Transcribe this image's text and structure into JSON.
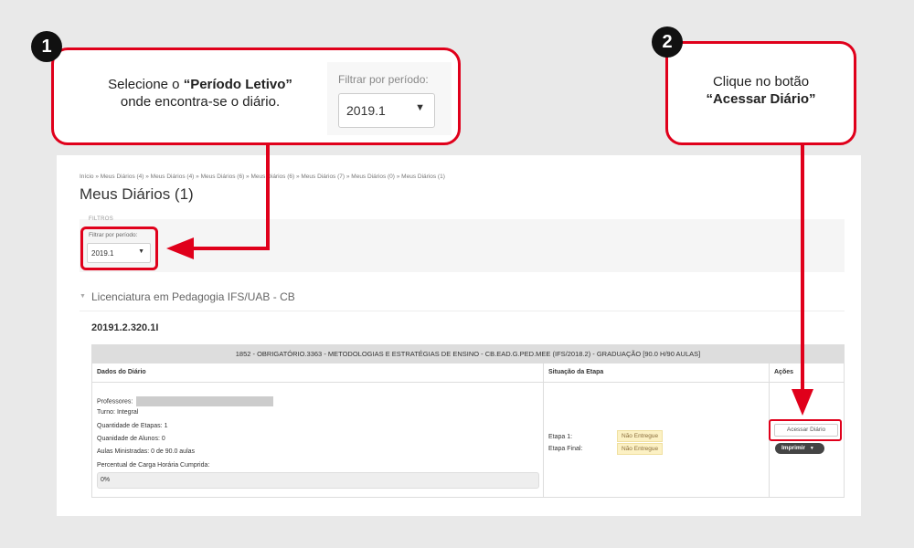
{
  "step1": {
    "number": "1",
    "text_prefix": "Selecione o ",
    "text_bold": "“Período Letivo”",
    "text_suffix": "onde encontra-se o diário.",
    "zoom_label": "Filtrar por período:",
    "zoom_value": "2019.1",
    "caret": "▼"
  },
  "step2": {
    "number": "2",
    "text_line1": "Clique no botão",
    "text_bold": "“Acessar Diário”"
  },
  "page": {
    "breadcrumb": "Início » Meus Diários (4) » Meus Diários (4) » Meus Diários (6) » Meus Diários (6) » Meus Diários (7) » Meus Diários (0) » Meus Diários (1)",
    "title": "Meus Diários (1)",
    "filters_label": "FILTROS",
    "filter_label": "Filtrar por período:",
    "filter_value": "2019.1",
    "caret": "▼",
    "course_toggle": "▼",
    "course_title": "Licenciatura em Pedagogia IFS/UAB - CB",
    "class_code": "20191.2.320.1I"
  },
  "table": {
    "caption": "1852 - OBRIGATÓRIO.3363 - METODOLOGIAS E ESTRATÉGIAS DE ENSINO - CB.EAD.G.PED.MEE (IFS/2018.2) - GRADUAÇÃO [90.0 H/90 AULAS]",
    "headers": [
      "Dados do Diário",
      "Situação da Etapa",
      "Ações"
    ],
    "details": {
      "professores_label": "Professores:",
      "turno_label": "Turno:",
      "turno_value": "Integral",
      "etapas_label": "Quantidade de Etapas:",
      "etapas_value": "1",
      "alunos_label": "Quanidade de Alunos:",
      "alunos_value": "0",
      "aulas_label": "Aulas Ministradas:",
      "aulas_value": "0 de 90.0 aulas",
      "percentual_label": "Percentual de Carga Horária Cumprida:",
      "percentual_value": "0%"
    },
    "stages": [
      {
        "label": "Etapa 1:",
        "status": "Não Entregue"
      },
      {
        "label": "Etapa Final:",
        "status": "Não Entregue"
      }
    ],
    "actions": {
      "access_label": "Acessar Diário",
      "print_label": "Imprimir",
      "print_caret": "▼"
    }
  },
  "colors": {
    "highlight": "#e0001b",
    "badge_bg": "#fcf1c4"
  }
}
